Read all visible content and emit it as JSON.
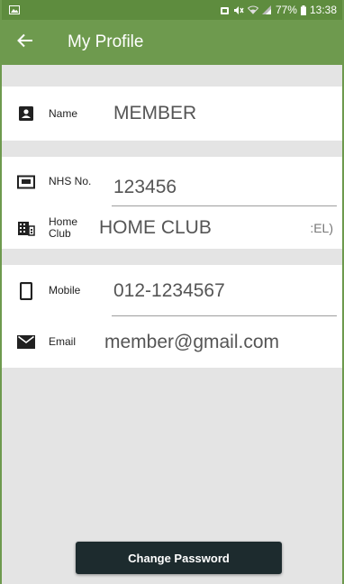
{
  "colors": {
    "status_bar": "#5e8c3e",
    "app_bar": "#6e9a4e",
    "background": "#e4e4e4",
    "button": "#1d2b2e"
  },
  "status_bar": {
    "battery": "77%",
    "time": "13:38",
    "icons": [
      "image-notification-icon",
      "alarm-icon",
      "mute-icon",
      "wifi-icon",
      "signal-icon",
      "battery-icon"
    ]
  },
  "app_bar": {
    "title": "My Profile",
    "back_icon": "arrow-back-icon"
  },
  "profile": {
    "name": {
      "label": "Name",
      "value": "MEMBER",
      "icon": "contact-card-icon"
    },
    "nhs": {
      "label": "NHS No.",
      "value": "123456",
      "icon": "id-card-icon"
    },
    "home_club": {
      "label_line1": "Home",
      "label_line2": "Club",
      "value": "HOME CLUB",
      "suffix": ":EL)",
      "icon": "building-icon"
    },
    "mobile": {
      "label": "Mobile",
      "value": "012-1234567",
      "icon": "phone-icon"
    },
    "email": {
      "label": "Email",
      "value": "member@gmail.com",
      "icon": "mail-icon"
    }
  },
  "actions": {
    "change_password": "Change Password"
  }
}
